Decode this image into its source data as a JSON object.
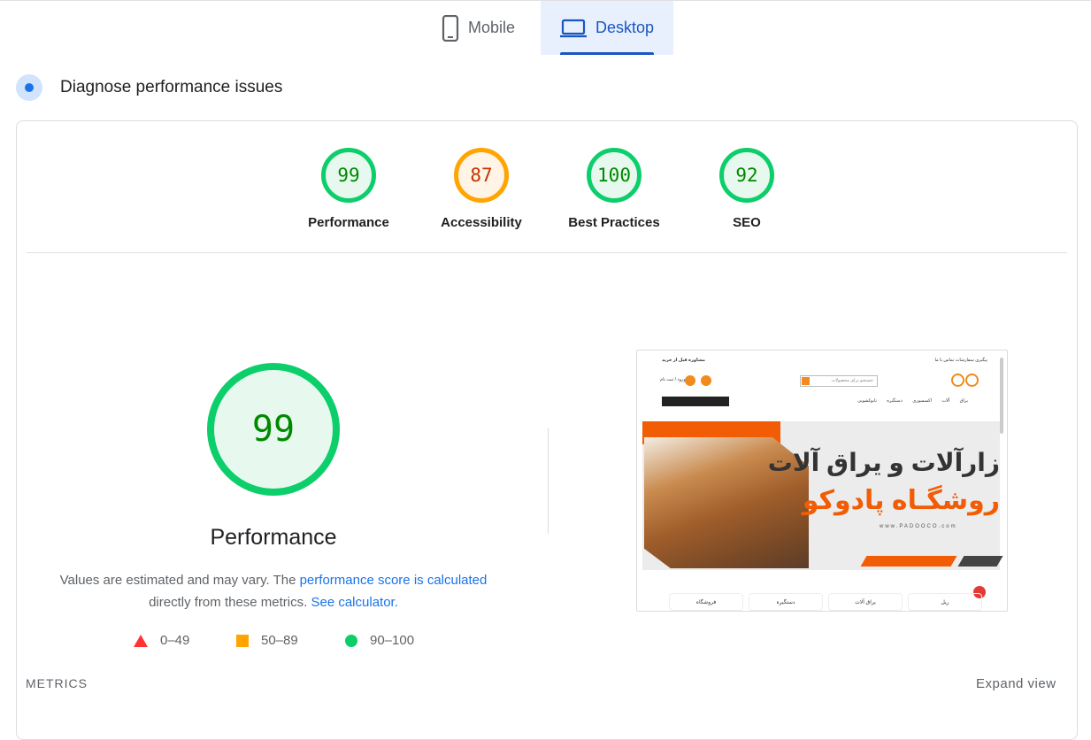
{
  "tabs": [
    {
      "label": "Mobile",
      "icon": "smartphone-icon",
      "active": false
    },
    {
      "label": "Desktop",
      "icon": "laptop-icon",
      "active": true
    }
  ],
  "diagnose": {
    "title": "Diagnose performance issues"
  },
  "scores": [
    {
      "value": "99",
      "label": "Performance",
      "status": "green"
    },
    {
      "value": "87",
      "label": "Accessibility",
      "status": "orange"
    },
    {
      "value": "100",
      "label": "Best Practices",
      "status": "green"
    },
    {
      "value": "92",
      "label": "SEO",
      "status": "green"
    }
  ],
  "performance": {
    "score": "99",
    "label": "Performance",
    "desc_prefix": "Values are estimated and may vary. The ",
    "desc_link": "performance score is calculated",
    "desc_middle": "directly from these metrics. ",
    "calc_link": "See calculator."
  },
  "legend": [
    {
      "label": "0–49",
      "shape": "triangle",
      "color": "#ff3333"
    },
    {
      "label": "50–89",
      "shape": "square",
      "color": "#ffa400"
    },
    {
      "label": "90–100",
      "shape": "circle",
      "color": "#0cce6b"
    }
  ],
  "thumbnail": {
    "top_left": "مشاوره قبل از خرید",
    "top_right": "پیگیری سفارشات    تماس با ما",
    "login": "ورود / ثبت نام",
    "search_placeholder": "جستجو برای محصولات",
    "nav_links": "یراق آلات   اکسسوری   دستگیره   تابوکشویی",
    "hero_line1": "زارآلات و یراق آلات",
    "hero_line2": "روشگـاه پادوکو",
    "url": "www.PADOOCO.com",
    "categories": [
      "فروشگاه",
      "دستگیره",
      "یراق آلات",
      "ریل"
    ]
  },
  "colors": {
    "pass": "#0cce6b",
    "average": "#ffa400",
    "fail": "#ff3333",
    "link": "#1a73e8",
    "active_tab": "#1a55c0"
  },
  "metrics": {
    "label": "METRICS",
    "expand": "Expand view"
  }
}
